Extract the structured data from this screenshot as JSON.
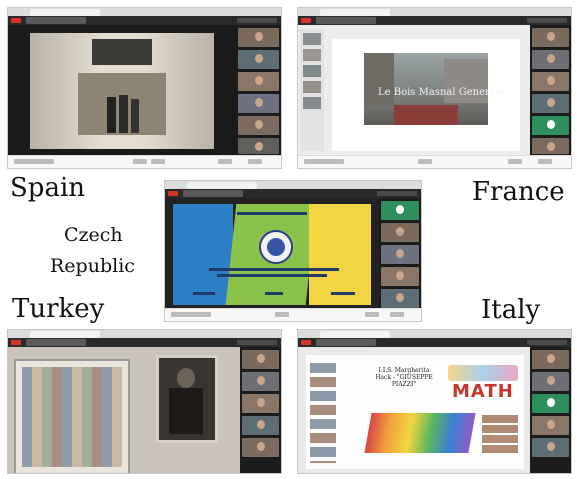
{
  "labels": {
    "spain": "Spain",
    "czech_line1": "Czech",
    "czech_line2": "Republic",
    "france": "France",
    "turkey": "Turkey",
    "italy": "Italy"
  },
  "screens": {
    "france": {
      "slide_photo_text": "Le Bois Masnal Generale"
    },
    "italy": {
      "slide_title_line1": "I.I.S. Margherita",
      "slide_title_line2": "Hack - \"GIUSEPPE",
      "slide_title_line3": "PIAZZI\"",
      "slide_badge": "MATH"
    }
  },
  "colors": {
    "record_red": "#d8352a",
    "dark_bar": "#2a2a2a",
    "czech_blue": "#2f7fc7",
    "czech_green": "#8bc34a",
    "czech_yellow": "#f2d541"
  },
  "icons": [
    "record-icon",
    "school-seal-icon"
  ]
}
